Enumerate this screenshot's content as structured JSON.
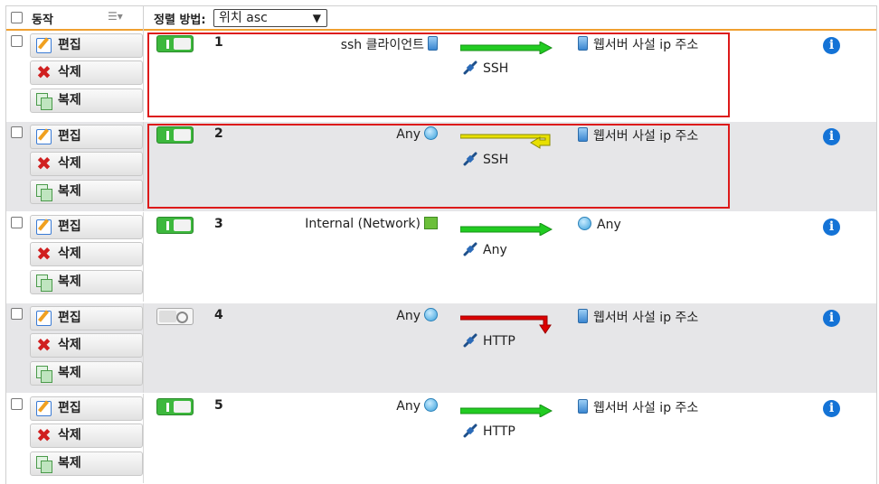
{
  "header": {
    "action_label": "동작",
    "sort_label": "정렬 방법:",
    "sort_value": "위치 asc"
  },
  "buttons": {
    "edit": "편집",
    "delete": "삭제",
    "copy": "복제"
  },
  "colors": {
    "allow": "#22cc22",
    "redirect": "#e8e000",
    "deny": "#dd0000",
    "highlight": "#dd1a1a",
    "header_line": "#f0a030"
  },
  "rules": [
    {
      "position": "1",
      "enabled": true,
      "source": "ssh 클라이언트",
      "source_icon": "server-icon",
      "action": "allow",
      "service": "SSH",
      "destination": "웹서버 사설 ip 주소",
      "destination_icon": "server-icon",
      "highlighted": true
    },
    {
      "position": "2",
      "enabled": true,
      "source": "Any",
      "source_icon": "globe-icon",
      "action": "redirect",
      "service": "SSH",
      "destination": "웹서버 사설 ip 주소",
      "destination_icon": "server-icon",
      "highlighted": true
    },
    {
      "position": "3",
      "enabled": true,
      "source": "Internal (Network)",
      "source_icon": "network-flag-icon",
      "action": "allow",
      "service": "Any",
      "destination": "Any",
      "destination_icon": "globe-icon",
      "highlighted": false
    },
    {
      "position": "4",
      "enabled": false,
      "source": "Any",
      "source_icon": "globe-icon",
      "action": "deny",
      "service": "HTTP",
      "destination": "웹서버 사설 ip 주소",
      "destination_icon": "server-icon",
      "highlighted": false
    },
    {
      "position": "5",
      "enabled": true,
      "source": "Any",
      "source_icon": "globe-icon",
      "action": "allow",
      "service": "HTTP",
      "destination": "웹서버 사설 ip 주소",
      "destination_icon": "server-icon",
      "highlighted": false
    }
  ]
}
